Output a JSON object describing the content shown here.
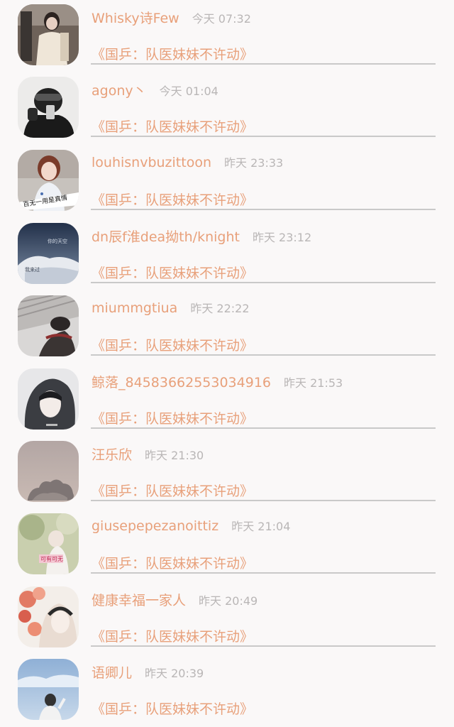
{
  "messages": [
    {
      "name": "Whisky诗Few",
      "time": "今天 07:32",
      "title": "《国乒：队医妹妹不许动》"
    },
    {
      "name": "agony丶",
      "time": "今天 01:04",
      "title": "《国乒：队医妹妹不许动》"
    },
    {
      "name": "louhisnvbuzittoon",
      "time": "昨天 23:33",
      "title": "《国乒：队医妹妹不许动》"
    },
    {
      "name": "dn辰f淮dea拗th/knight",
      "time": "昨天 23:12",
      "title": "《国乒：队医妹妹不许动》",
      "avatar_text": [
        "你的天空",
        "我来过"
      ]
    },
    {
      "name": "miummgtiua",
      "time": "昨天 22:22",
      "title": "《国乒：队医妹妹不许动》"
    },
    {
      "name": "鲸落_84583662553034916",
      "time": "昨天 21:53",
      "title": "《国乒：队医妹妹不许动》"
    },
    {
      "name": "汪乐欣",
      "time": "昨天 21:30",
      "title": "《国乒：队医妹妹不许动》"
    },
    {
      "name": "giusepepezanoittiz",
      "time": "昨天 21:04",
      "title": "《国乒：队医妹妹不许动》",
      "avatar_text": [
        "可有可无"
      ]
    },
    {
      "name": "健康幸福一家人",
      "time": "昨天 20:49",
      "title": "《国乒：队医妹妹不许动》"
    },
    {
      "name": "语卿儿",
      "time": "昨天 20:39",
      "title": "《国乒：队医妹妹不许动》"
    }
  ],
  "avatar3_text": "百无一用是真情",
  "colors": {
    "name": "#e8a07a",
    "time": "#b9b6b6",
    "divider": "#c9c9c9",
    "background": "#faf8f8"
  }
}
